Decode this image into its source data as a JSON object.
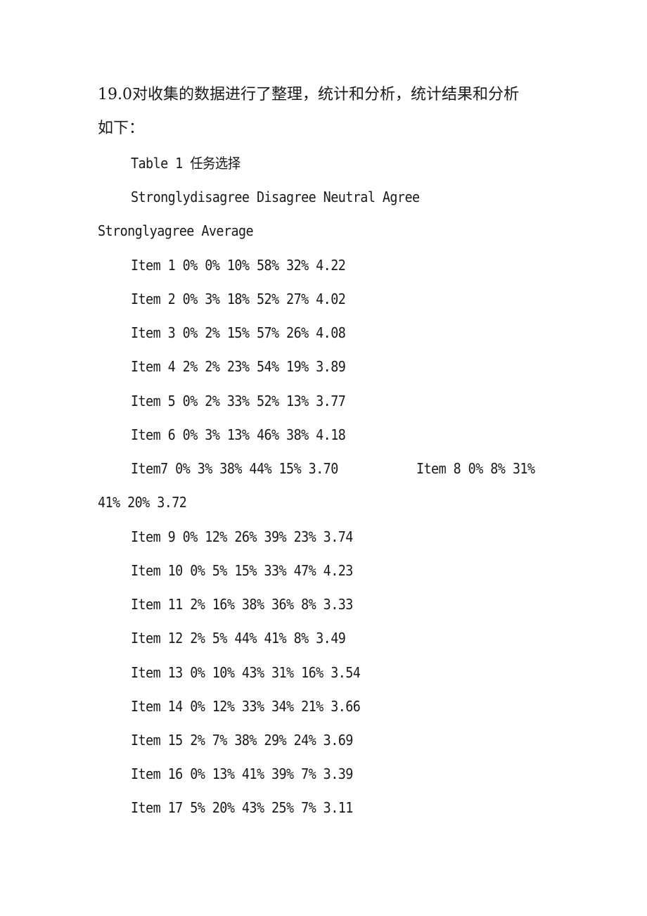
{
  "document": {
    "intro_line1": "19.0对收集的数据进行了整理，统计和分析，统计结果和分析",
    "intro_line2": "如下：",
    "table_title": "Table 1 任务选择",
    "header_line1": "Stronglydisagree Disagree Neutral Agree",
    "header_line2": "Stronglyagree Average",
    "columns": [
      "Stronglydisagree",
      "Disagree",
      "Neutral",
      "Agree",
      "Stronglyagree",
      "Average"
    ],
    "rows": [
      {
        "text": "Item 1 0% 0% 10% 58% 32% 4.22",
        "item": "Item 1",
        "values": [
          "0%",
          "0%",
          "10%",
          "58%",
          "32%",
          "4.22"
        ]
      },
      {
        "text": "Item 2 0% 3% 18% 52% 27% 4.02",
        "item": "Item 2",
        "values": [
          "0%",
          "3%",
          "18%",
          "52%",
          "27%",
          "4.02"
        ]
      },
      {
        "text": "Item 3 0% 2% 15% 57% 26% 4.08",
        "item": "Item 3",
        "values": [
          "0%",
          "2%",
          "15%",
          "57%",
          "26%",
          "4.08"
        ]
      },
      {
        "text": "Item 4 2% 2% 23% 54% 19% 3.89",
        "item": "Item 4",
        "values": [
          "2%",
          "2%",
          "23%",
          "54%",
          "19%",
          "3.89"
        ]
      },
      {
        "text": "Item 5 0% 2% 33% 52% 13% 3.77",
        "item": "Item 5",
        "values": [
          "0%",
          "2%",
          "33%",
          "52%",
          "13%",
          "3.77"
        ]
      },
      {
        "text": "Item 6 0% 3% 13% 46% 38% 4.18",
        "item": "Item 6",
        "values": [
          "0%",
          "3%",
          "13%",
          "46%",
          "38%",
          "4.18"
        ]
      },
      {
        "text": "Item7 0% 3% 38% 44% 15% 3.70",
        "item": "Item7",
        "values": [
          "0%",
          "3%",
          "38%",
          "44%",
          "15%",
          "3.70"
        ]
      },
      {
        "text_part1": "Item 8 0% 8% 31%",
        "text_part2": "41% 20% 3.72",
        "item": "Item 8",
        "values": [
          "0%",
          "8%",
          "31%",
          "41%",
          "20%",
          "3.72"
        ]
      },
      {
        "text": "Item 9 0% 12% 26% 39% 23% 3.74",
        "item": "Item 9",
        "values": [
          "0%",
          "12%",
          "26%",
          "39%",
          "23%",
          "3.74"
        ]
      },
      {
        "text": "Item 10 0% 5% 15% 33% 47% 4.23",
        "item": "Item 10",
        "values": [
          "0%",
          "5%",
          "15%",
          "33%",
          "47%",
          "4.23"
        ]
      },
      {
        "text": "Item 11 2% 16% 38% 36% 8% 3.33",
        "item": "Item 11",
        "values": [
          "2%",
          "16%",
          "38%",
          "36%",
          "8%",
          "3.33"
        ]
      },
      {
        "text": "Item 12 2% 5% 44% 41% 8% 3.49",
        "item": "Item 12",
        "values": [
          "2%",
          "5%",
          "44%",
          "41%",
          "8%",
          "3.49"
        ]
      },
      {
        "text": "Item 13 0% 10% 43% 31% 16% 3.54",
        "item": "Item 13",
        "values": [
          "0%",
          "10%",
          "43%",
          "31%",
          "16%",
          "3.54"
        ]
      },
      {
        "text": "Item 14 0% 12% 33% 34% 21% 3.66",
        "item": "Item 14",
        "values": [
          "0%",
          "12%",
          "33%",
          "34%",
          "21%",
          "3.66"
        ]
      },
      {
        "text": "Item 15 2% 7% 38% 29% 24% 3.69",
        "item": "Item 15",
        "values": [
          "2%",
          "7%",
          "38%",
          "29%",
          "24%",
          "3.69"
        ]
      },
      {
        "text": "Item 16 0% 13% 41% 39% 7% 3.39",
        "item": "Item 16",
        "values": [
          "0%",
          "13%",
          "41%",
          "39%",
          "7%",
          "3.39"
        ]
      },
      {
        "text": "Item 17 5% 20% 43% 25% 7% 3.11",
        "item": "Item 17",
        "values": [
          "5%",
          "20%",
          "43%",
          "25%",
          "7%",
          "3.11"
        ]
      }
    ]
  }
}
